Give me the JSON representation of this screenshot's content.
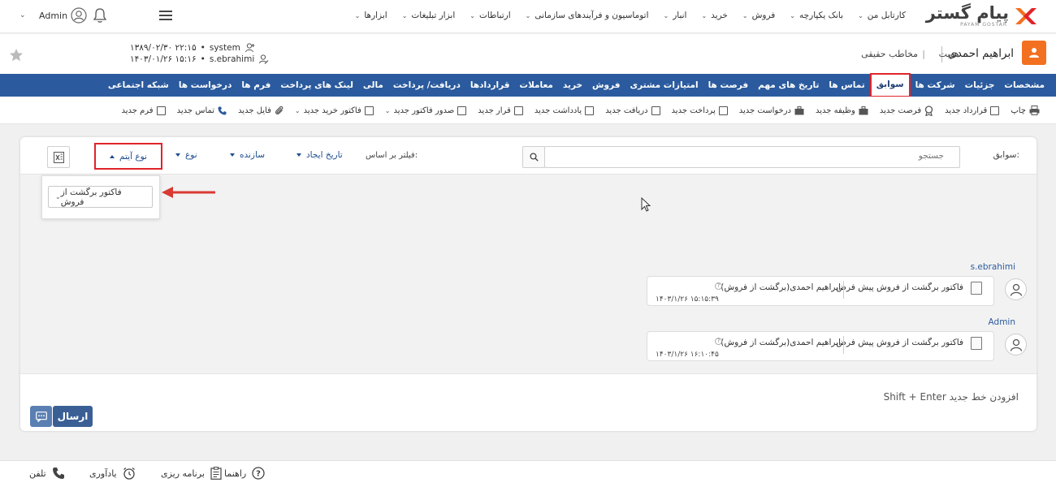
{
  "app": {
    "brand_name": "پیام گستر",
    "brand_sub": "PAYAM GOSTAR",
    "brand_colors": {
      "orange": "#f37021",
      "dark": "#404040",
      "blue": "#2b5b9e",
      "highlight": "#e0242a"
    }
  },
  "topmenu": [
    {
      "label": "کارتابل من",
      "chevron": true
    },
    {
      "label": "بانک یکپارچه",
      "chevron": true
    },
    {
      "label": "فروش",
      "chevron": true
    },
    {
      "label": "خرید",
      "chevron": true
    },
    {
      "label": "انبار",
      "chevron": true
    },
    {
      "label": "اتوماسیون و فرآیندهای سازمانی",
      "chevron": true
    },
    {
      "label": "ارتباطات",
      "chevron": true
    },
    {
      "label": "ابزار تبلیغات",
      "chevron": true
    },
    {
      "label": "ابزارها",
      "chevron": true
    }
  ],
  "user": {
    "name": "Admin"
  },
  "identity": {
    "name": "ابراهیم احمدی",
    "label": "هویت",
    "type": "مخاطب حقیقی",
    "audit": [
      {
        "user": "system",
        "datetime": "۱۳۸۹/۰۲/۳۰ ۲۲:۱۵"
      },
      {
        "user": "s.ebrahimi",
        "datetime": "۱۴۰۳/۰۱/۲۶ ۱۵:۱۶"
      }
    ]
  },
  "tabs": [
    {
      "label": "مشخصات",
      "active": false
    },
    {
      "label": "جزئیات",
      "active": false
    },
    {
      "label": "شرکت ها",
      "active": false
    },
    {
      "label": "سوابق",
      "active": true
    },
    {
      "label": "تماس ها",
      "active": false
    },
    {
      "label": "تاریخ های مهم",
      "active": false
    },
    {
      "label": "فرصت ها",
      "active": false
    },
    {
      "label": "امتیازات مشتری",
      "active": false
    },
    {
      "label": "فروش",
      "active": false
    },
    {
      "label": "خرید",
      "active": false
    },
    {
      "label": "معاملات",
      "active": false
    },
    {
      "label": "قراردادها",
      "active": false
    },
    {
      "label": "دریافت/ پرداخت",
      "active": false
    },
    {
      "label": "مالی",
      "active": false
    },
    {
      "label": "لینک های پرداخت",
      "active": false
    },
    {
      "label": "فرم ها",
      "active": false
    },
    {
      "label": "درخواست ها",
      "active": false
    },
    {
      "label": "شبکه اجتماعی",
      "active": false
    }
  ],
  "actions": [
    {
      "label": "چاپ",
      "icon": "printer-icon"
    },
    {
      "label": "قرارداد جدید",
      "icon": "document-icon"
    },
    {
      "label": "فرصت جدید",
      "icon": "award-icon"
    },
    {
      "label": "وظیفه جدید",
      "icon": "briefcase-icon"
    },
    {
      "label": "درخواست جدید",
      "icon": "briefcase-icon"
    },
    {
      "label": "پرداخت جدید",
      "icon": "payment-icon"
    },
    {
      "label": "دریافت جدید",
      "icon": "receive-icon"
    },
    {
      "label": "یادداشت جدید",
      "icon": "note-icon"
    },
    {
      "label": "قرار جدید",
      "icon": "calendar-icon"
    },
    {
      "label": "صدور فاکتور جدید",
      "icon": "invoice-icon",
      "chevron": true
    },
    {
      "label": "فاکتور خرید جدید",
      "icon": "invoice-icon",
      "chevron": true
    },
    {
      "label": "فایل جدید",
      "icon": "paperclip-icon"
    },
    {
      "label": "تماس جدید",
      "icon": "phone-icon"
    },
    {
      "label": "فرم جدید",
      "icon": "form-icon"
    }
  ],
  "history": {
    "label": "سوابق:",
    "search_placeholder": "جستجو",
    "filter_label": "فیلتر بر اساس:",
    "filters": {
      "date": "تاریخ ایجاد",
      "creator": "سازنده",
      "kind": "نوع",
      "item_type": "نوع آیتم"
    },
    "dropdown_selected": "فاکتور برگشت از فروش"
  },
  "feed": [
    {
      "user": "s.ebrahimi",
      "title": "فاکتور برگشت از فروش پیش فرض",
      "subject": "ابراهیم احمدی(برگشت از فروش)",
      "time": "۱۴۰۳/۱/۲۶ ۱۵:۱۵:۳۹"
    },
    {
      "user": "Admin",
      "title": "فاکتور برگشت از فروش پیش فرض",
      "subject": "ابراهیم احمدی(برگشت از فروش)",
      "time": "۱۴۰۳/۱/۲۶ ۱۶:۱۰:۴۵"
    }
  ],
  "compose": {
    "hint": "Shift + Enter افزودن خط جدید",
    "send_label": "ارسال"
  },
  "bottombar": {
    "guide": "راهنما",
    "planning": "برنامه ریزی",
    "reminder": "یادآوری",
    "phone": "تلفن"
  }
}
